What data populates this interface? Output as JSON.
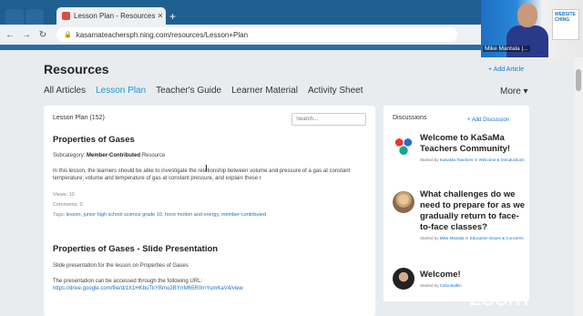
{
  "browser": {
    "tab_title": "Lesson Plan - Resources - KaSaM...",
    "tab_close": "✕",
    "new_tab": "+",
    "url": "kasamateachersph.ning.com/resources/Lesson+Plan",
    "back_icon": "←",
    "forward_icon": "→",
    "reload_icon": "↻"
  },
  "page": {
    "title": "Resources",
    "add_article": "+ Add Article",
    "categories": [
      "All Articles",
      "Lesson Plan",
      "Teacher's Guide",
      "Learner Material",
      "Activity Sheet"
    ],
    "active_category": "Lesson Plan",
    "more": "More ▾"
  },
  "main": {
    "count_label": "Lesson Plan (152)",
    "search_placeholder": "Search...",
    "articles": [
      {
        "title": "Properties of Gases",
        "subcategory_label": "Subcategory:",
        "subcategory_value": "Member-Contributed",
        "subcategory_suffix": "Resource",
        "body": "In this lesson, the learners should be able to investigate the relationship between volume and pressure of a gas at constant temperature; volume and temperature of gas at constant pressure, and explain these r",
        "views": "Views: 10",
        "comments": "Comments: 0",
        "tags_label": "Tags:",
        "tags": "lesson, junior high school science grade 10, force motion and energy, member-contributed"
      },
      {
        "title": "Properties of Gases - Slide Presentation",
        "body1": "Slide presentation for the lesson on Properties of Gases",
        "body2": "The presentation can be accessed through the following URL:",
        "url": "https://drive.google.com/file/d/1X1HKbuTkYBmo2BYrrM65R0rnYumKaV4/view"
      }
    ]
  },
  "discussions": {
    "heading": "Discussions",
    "add": "+ Add Discussion",
    "items": [
      {
        "title": "Welcome to KaSaMa Teachers Community!",
        "started_by": "Started by",
        "author": "KaSaMa Teachers",
        "in": "in",
        "forum": "Welcome & Introductions"
      },
      {
        "title": "What challenges do we need to prepare for as we gradually return to face-to-face classes?",
        "started_by": "Started by",
        "author": "Mike Mantala",
        "in": "in",
        "forum": "Education Issues & Concerns"
      },
      {
        "title": "Welcome!",
        "started_by": "Started by",
        "author": "Celia Balbin",
        "in": "",
        "forum": ""
      }
    ]
  },
  "webcam": {
    "name": "Mike Mantala |...",
    "screen_text": "WEBSITE CHING"
  },
  "watermark": "zoom",
  "colors": {
    "accent": "#1a9ad6",
    "link": "#1a73c8",
    "chrome": "#1f5f8f"
  }
}
